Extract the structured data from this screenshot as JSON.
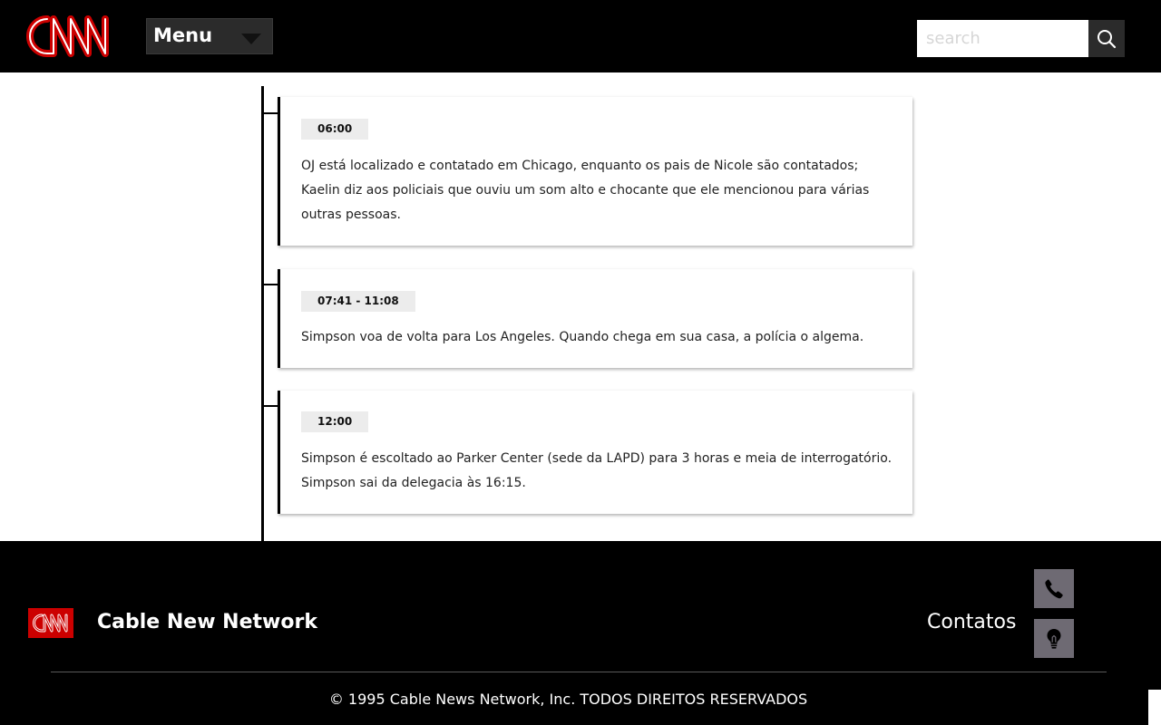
{
  "header": {
    "logo_text": "CNN",
    "menu_label": "Menu",
    "search_placeholder": "search",
    "search_value": ""
  },
  "timeline": {
    "entries": [
      {
        "time": "06:00",
        "lines": [
          "OJ está localizado e contatado em Chicago, enquanto os pais de Nicole são contatados;",
          "Kaelin diz aos policiais que ouviu um som alto e chocante que ele mencionou para várias outras pessoas."
        ]
      },
      {
        "time": "07:41 - 11:08",
        "lines": [
          "Simpson voa de volta para Los Angeles. Quando chega em sua casa, a polícia o algema."
        ]
      },
      {
        "time": "12:00",
        "lines": [
          "Simpson é escoltado ao Parker Center (sede da LAPD) para 3 horas e meia de interrogatório.",
          "Simpson sai da delegacia às 16:15."
        ]
      }
    ]
  },
  "footer": {
    "logo_text": "CNN",
    "title": "Cable New Network",
    "contacts_label": "Contatos",
    "contact_icons": [
      "phone-icon",
      "lightbulb-icon"
    ],
    "copyright": "© 1995 Cable News Network, Inc. TODOS DIREITOS RESERVADOS"
  },
  "colors": {
    "brand_red": "#cc0000",
    "header_bg": "#000000",
    "icon_box_bg": "#6e6a73",
    "badge_bg": "#ececec"
  }
}
